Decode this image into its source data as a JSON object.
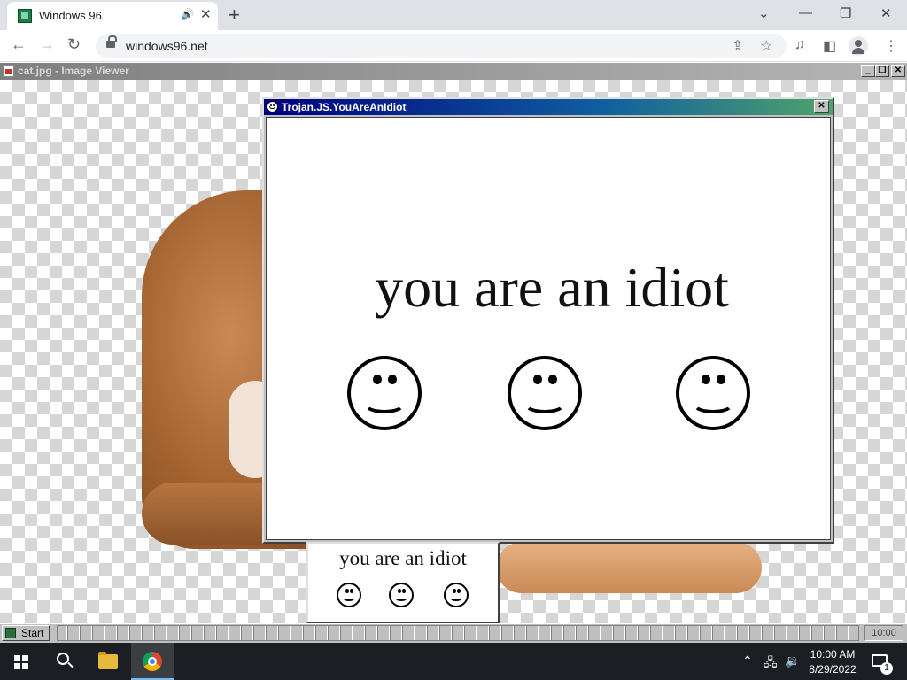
{
  "browser": {
    "tab_title": "Windows 96",
    "url": "windows96.net",
    "tab_close": "✕",
    "new_tab": "+",
    "controls": {
      "chevron": "⌄",
      "minimize": "—",
      "restore": "❐",
      "close": "✕"
    }
  },
  "viewer": {
    "title": "cat.jpg - Image Viewer",
    "btn_min": "_",
    "btn_max": "❐",
    "btn_close": "✕"
  },
  "trojan": {
    "title": "Trojan.JS.YouAreAnIdiot",
    "message": "you are an idiot",
    "close": "✕",
    "smiley_count": 3
  },
  "mini_popup": {
    "message": "you are an idiot"
  },
  "w96_taskbar": {
    "start_label": "Start",
    "clock": "10:00"
  },
  "win10_taskbar": {
    "time": "10:00 AM",
    "date": "8/29/2022",
    "notification_count": "1"
  },
  "colors": {
    "chrome_tabstrip": "#dee1e6",
    "w96_face": "#c0c0c0",
    "trojan_title_start": "#000080",
    "trojan_title_end": "#4fa36a",
    "win10_taskbar": "#1b1e22"
  }
}
